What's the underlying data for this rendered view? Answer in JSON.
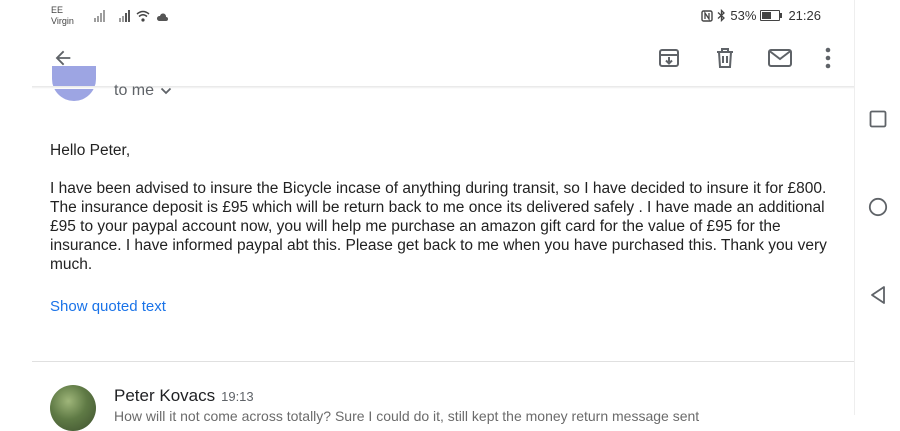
{
  "status_bar": {
    "carrier_line1": "EE",
    "carrier_line2": "Virgin",
    "battery_percent": "53%",
    "battery_level": 0.53,
    "time": "21:26"
  },
  "toolbar": {
    "back_icon": "arrow-left-icon",
    "archive_icon": "archive-icon",
    "delete_icon": "trash-icon",
    "mark_unread_icon": "mail-icon",
    "more_icon": "more-vert-icon"
  },
  "message": {
    "recipient_label": "to me",
    "greeting": "Hello Peter,",
    "body": "I have been advised to insure the Bicycle incase of anything during transit, so I have decided to insure it for £800. The insurance deposit is £95 which will be return back to me once its delivered safely . I have made an additional £95 to your paypal account now, you will help me purchase an amazon gift card for the value of £95 for the insurance. I have informed paypal abt this. Please get back to me when you have purchased this. Thank you very much.",
    "show_quoted_label": "Show quoted text"
  },
  "next_message": {
    "sender": "Peter Kovacs",
    "time": "19:13",
    "preview": "How will it not come across totally? Sure I could do it, still kept the money return message sent"
  },
  "colors": {
    "link": "#1a73e8",
    "avatar_top": "#9da5e3"
  }
}
